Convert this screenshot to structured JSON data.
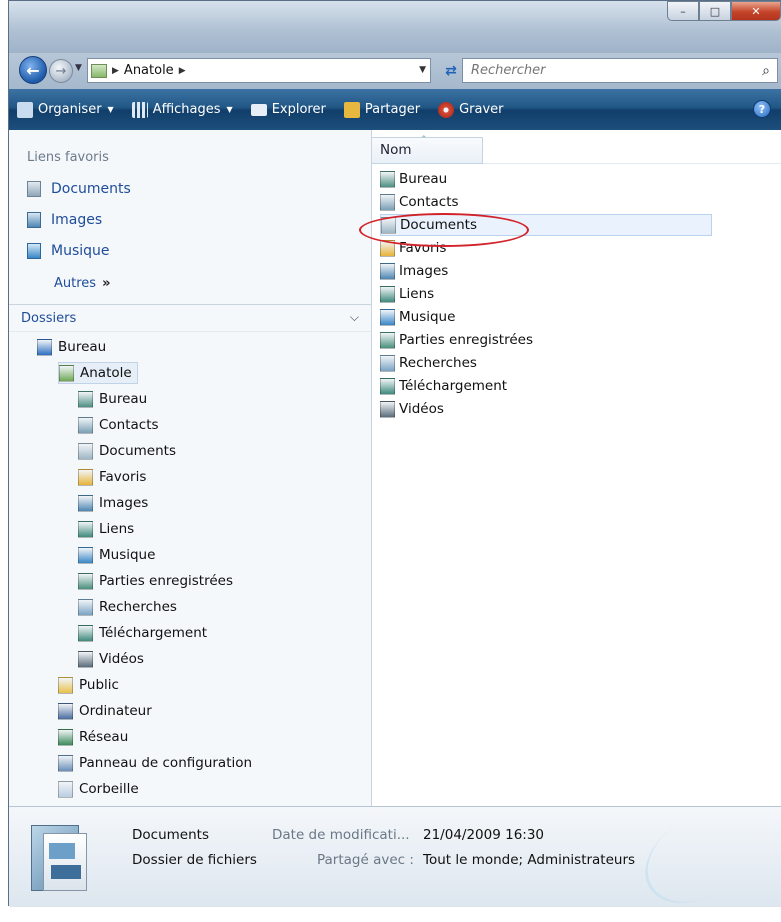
{
  "nav": {
    "breadcrumb": "Anatole",
    "search_placeholder": "Rechercher"
  },
  "toolbar": {
    "organise": "Organiser",
    "views": "Affichages",
    "explorer": "Explorer",
    "share": "Partager",
    "burn": "Graver"
  },
  "sidebar": {
    "favorites_title": "Liens favoris",
    "favorites": [
      {
        "label": "Documents",
        "icon": "documents-icon"
      },
      {
        "label": "Images",
        "icon": "pictures-icon"
      },
      {
        "label": "Musique",
        "icon": "music-icon"
      }
    ],
    "more_label": "Autres",
    "more_glyph": "»",
    "folders_title": "Dossiers"
  },
  "tree": [
    {
      "label": "Bureau",
      "icon": "desktop-icon",
      "color": "#2e6fc0"
    },
    {
      "label": "Anatole",
      "icon": "user-folder-icon",
      "color": "#6fa957"
    },
    {
      "label": "Bureau",
      "icon": "desktop-folder-icon",
      "color": "#4d8f83"
    },
    {
      "label": "Contacts",
      "icon": "contacts-icon",
      "color": "#7a9fb5"
    },
    {
      "label": "Documents",
      "icon": "documents-icon",
      "color": "#9fb6c4"
    },
    {
      "label": "Favoris",
      "icon": "favorites-icon",
      "color": "#e8b43a"
    },
    {
      "label": "Images",
      "icon": "pictures-icon",
      "color": "#4e86b3"
    },
    {
      "label": "Liens",
      "icon": "links-icon",
      "color": "#3f8a7c"
    },
    {
      "label": "Musique",
      "icon": "music-icon",
      "color": "#3a86c7"
    },
    {
      "label": "Parties enregistrées",
      "icon": "saved-games-icon",
      "color": "#4a907b"
    },
    {
      "label": "Recherches",
      "icon": "searches-icon",
      "color": "#7aa3c4"
    },
    {
      "label": "Téléchargement",
      "icon": "downloads-icon",
      "color": "#3f8a7c"
    },
    {
      "label": "Vidéos",
      "icon": "videos-icon",
      "color": "#5a6c7a"
    },
    {
      "label": "Public",
      "icon": "public-folder-icon",
      "color": "#e8c04a"
    },
    {
      "label": "Ordinateur",
      "icon": "computer-icon",
      "color": "#4a6ea0"
    },
    {
      "label": "Réseau",
      "icon": "network-icon",
      "color": "#3d8a5a"
    },
    {
      "label": "Panneau de configuration",
      "icon": "control-panel-icon",
      "color": "#6b8fb8"
    },
    {
      "label": "Corbeille",
      "icon": "recycle-bin-icon",
      "color": "#b9cde0"
    }
  ],
  "files": {
    "column_name": "Nom",
    "items": [
      {
        "label": "Bureau",
        "icon": "desktop-folder-icon",
        "color": "#4d8f83"
      },
      {
        "label": "Contacts",
        "icon": "contacts-icon",
        "color": "#7a9fb5"
      },
      {
        "label": "Documents",
        "icon": "documents-icon",
        "color": "#9fb6c4"
      },
      {
        "label": "Favoris",
        "icon": "favorites-icon",
        "color": "#e8b43a"
      },
      {
        "label": "Images",
        "icon": "pictures-icon",
        "color": "#4e86b3"
      },
      {
        "label": "Liens",
        "icon": "links-icon",
        "color": "#3f8a7c"
      },
      {
        "label": "Musique",
        "icon": "music-icon",
        "color": "#3a86c7"
      },
      {
        "label": "Parties enregistrées",
        "icon": "saved-games-icon",
        "color": "#4a907b"
      },
      {
        "label": "Recherches",
        "icon": "searches-icon",
        "color": "#7aa3c4"
      },
      {
        "label": "Téléchargement",
        "icon": "downloads-icon",
        "color": "#3f8a7c"
      },
      {
        "label": "Vidéos",
        "icon": "videos-icon",
        "color": "#5a6c7a"
      }
    ]
  },
  "details": {
    "name": "Documents",
    "type": "Dossier de fichiers",
    "modified_label": "Date de modificati...",
    "modified_value": "21/04/2009 16:30",
    "shared_label": "Partagé avec :",
    "shared_value": "Tout le monde; Administrateurs"
  },
  "colors": {
    "toolbar": "#215785",
    "link": "#1e4c9a",
    "annotation": "#d2232a"
  }
}
